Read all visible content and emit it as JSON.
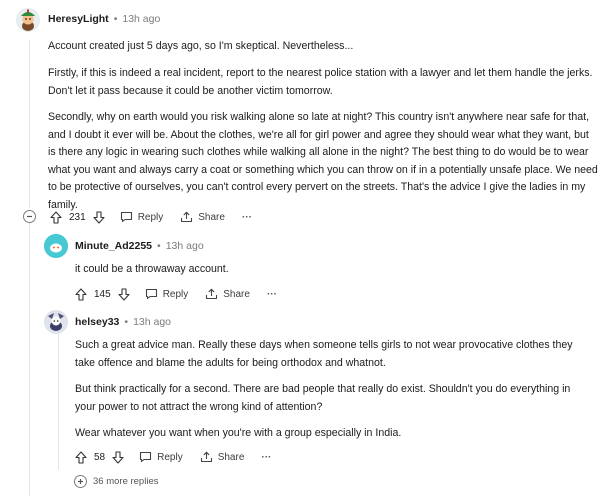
{
  "comments": [
    {
      "username": "HeresyLight",
      "time": "13h ago",
      "paragraphs": [
        "Account created just 5 days ago, so I'm skeptical. Nevertheless...",
        "Firstly, if this is indeed a real incident, report to the nearest police station with a lawyer and let them handle the jerks. Don't let it pass because it could be another victim tomorrow.",
        "Secondly, why on earth would you risk walking alone so late at night? This country isn't anywhere near safe for that, and I doubt it ever will be. About the clothes, we're all for girl power and agree they should wear what they want, but is there any logic in wearing such clothes while walking all alone in the night? The best thing to do would be to wear what you want and always carry a coat or something which you can throw on if in a potentially unsafe place. We need to be protective of ourselves, you can't control every pervert on the streets. That's the advice I give the ladies in my family."
      ],
      "votes": "231",
      "reply_label": "Reply",
      "share_label": "Share",
      "more_label": "···"
    },
    {
      "username": "Minute_Ad2255",
      "time": "13h ago",
      "paragraphs": [
        "it could be a throwaway account."
      ],
      "votes": "145",
      "reply_label": "Reply",
      "share_label": "Share",
      "more_label": "···"
    },
    {
      "username": "helsey33",
      "time": "13h ago",
      "paragraphs": [
        "Such a great advice man. Really these days when someone tells girls to not wear provocative clothes they take offence and blame the adults for being orthodox and whatnot.",
        "But think practically for a second. There are bad people that really do exist. Shouldn't you do everything in your power to not attract the wrong kind of attention?",
        "Wear whatever you want when you're with a group especially in India."
      ],
      "votes": "58",
      "reply_label": "Reply",
      "share_label": "Share",
      "more_label": "···"
    }
  ],
  "more_replies": "36 more replies",
  "dot": "•",
  "icons": {
    "upvote": "upvote-icon",
    "downvote": "downvote-icon",
    "reply": "reply-icon",
    "share": "share-icon",
    "collapse": "collapse-icon",
    "expand": "expand-icon"
  }
}
